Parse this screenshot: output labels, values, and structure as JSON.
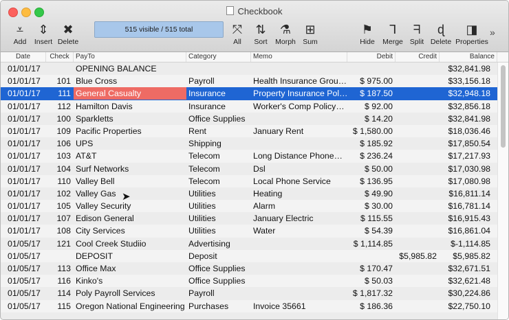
{
  "window": {
    "title": "Checkbook"
  },
  "toolbar": {
    "add": "Add",
    "insert": "Insert",
    "delete": "Delete",
    "status": "515 visible / 515 total",
    "all": "All",
    "sort": "Sort",
    "morph": "Morph",
    "sum": "Sum",
    "hide": "Hide",
    "merge": "Merge",
    "split": "Split",
    "delete2": "Delete",
    "properties": "Properties",
    "more": "»"
  },
  "columns": [
    "Date",
    "Check",
    "PayTo",
    "Category",
    "Memo",
    "Debit",
    "Credit",
    "Balance"
  ],
  "rows": [
    {
      "date": "01/01/17",
      "check": "",
      "payto": "OPENING BALANCE",
      "category": "",
      "memo": "",
      "debit": "",
      "credit": "",
      "balance": "$32,841.98"
    },
    {
      "date": "01/01/17",
      "check": "101",
      "payto": "Blue Cross",
      "category": "Payroll",
      "memo": "Health Insurance Grou…",
      "debit": "$ 975.00",
      "credit": "",
      "balance": "$33,156.18"
    },
    {
      "date": "01/01/17",
      "check": "111",
      "payto": "General Casualty",
      "category": "Insurance",
      "memo": "Property Insurance Pol…",
      "debit": "$ 187.50",
      "credit": "",
      "balance": "$32,948.18"
    },
    {
      "date": "01/01/17",
      "check": "112",
      "payto": "Hamilton Davis",
      "category": "Insurance",
      "memo": "Worker's Comp Policy…",
      "debit": "$ 92.00",
      "credit": "",
      "balance": "$32,856.18"
    },
    {
      "date": "01/01/17",
      "check": "100",
      "payto": "Sparkletts",
      "category": "Office Supplies",
      "memo": "",
      "debit": "$ 14.20",
      "credit": "",
      "balance": "$32,841.98"
    },
    {
      "date": "01/01/17",
      "check": "109",
      "payto": "Pacific Properties",
      "category": "Rent",
      "memo": "January Rent",
      "debit": "$ 1,580.00",
      "credit": "",
      "balance": "$18,036.46"
    },
    {
      "date": "01/01/17",
      "check": "106",
      "payto": "UPS",
      "category": "Shipping",
      "memo": "",
      "debit": "$ 185.92",
      "credit": "",
      "balance": "$17,850.54"
    },
    {
      "date": "01/01/17",
      "check": "103",
      "payto": "AT&T",
      "category": "Telecom",
      "memo": "Long Distance Phone…",
      "debit": "$ 236.24",
      "credit": "",
      "balance": "$17,217.93"
    },
    {
      "date": "01/01/17",
      "check": "104",
      "payto": "Surf Networks",
      "category": "Telecom",
      "memo": "Dsl",
      "debit": "$ 50.00",
      "credit": "",
      "balance": "$17,030.98"
    },
    {
      "date": "01/01/17",
      "check": "110",
      "payto": "Valley Bell",
      "category": "Telecom",
      "memo": "Local Phone Service",
      "debit": "$ 136.95",
      "credit": "",
      "balance": "$17,080.98"
    },
    {
      "date": "01/01/17",
      "check": "102",
      "payto": "Valley Gas",
      "category": "Utilities",
      "memo": "Heating",
      "debit": "$ 49.90",
      "credit": "",
      "balance": "$16,811.14"
    },
    {
      "date": "01/01/17",
      "check": "105",
      "payto": "Valley Security",
      "category": "Utilities",
      "memo": "Alarm",
      "debit": "$ 30.00",
      "credit": "",
      "balance": "$16,781.14"
    },
    {
      "date": "01/01/17",
      "check": "107",
      "payto": "Edison General",
      "category": "Utilities",
      "memo": "January Electric",
      "debit": "$ 115.55",
      "credit": "",
      "balance": "$16,915.43"
    },
    {
      "date": "01/01/17",
      "check": "108",
      "payto": "City Services",
      "category": "Utilities",
      "memo": "Water",
      "debit": "$ 54.39",
      "credit": "",
      "balance": "$16,861.04"
    },
    {
      "date": "01/05/17",
      "check": "121",
      "payto": "Cool Creek Studiio",
      "category": "Advertising",
      "memo": "",
      "debit": "$ 1,114.85",
      "credit": "",
      "balance": "$-1,114.85"
    },
    {
      "date": "01/05/17",
      "check": "",
      "payto": "DEPOSIT",
      "category": "Deposit",
      "memo": "",
      "debit": "",
      "credit": "$5,985.82",
      "balance": "$5,985.82"
    },
    {
      "date": "01/05/17",
      "check": "113",
      "payto": "Office Max",
      "category": "Office Supplies",
      "memo": "",
      "debit": "$ 170.47",
      "credit": "",
      "balance": "$32,671.51"
    },
    {
      "date": "01/05/17",
      "check": "116",
      "payto": "Kinko's",
      "category": "Office Supplies",
      "memo": "",
      "debit": "$ 50.03",
      "credit": "",
      "balance": "$32,621.48"
    },
    {
      "date": "01/05/17",
      "check": "114",
      "payto": "Poly Payroll Services",
      "category": "Payroll",
      "memo": "",
      "debit": "$ 1,817.32",
      "credit": "",
      "balance": "$30,224.86"
    },
    {
      "date": "01/05/17",
      "check": "115",
      "payto": "Oregon National Engineering",
      "category": "Purchases",
      "memo": "Invoice 35661",
      "debit": "$ 186.36",
      "credit": "",
      "balance": "$22,750.10"
    }
  ],
  "selected_row": 2,
  "colors": {
    "selection": "#1f65d3",
    "payto_highlight": "#ee6b64",
    "status_box": "#a8c7ea"
  }
}
